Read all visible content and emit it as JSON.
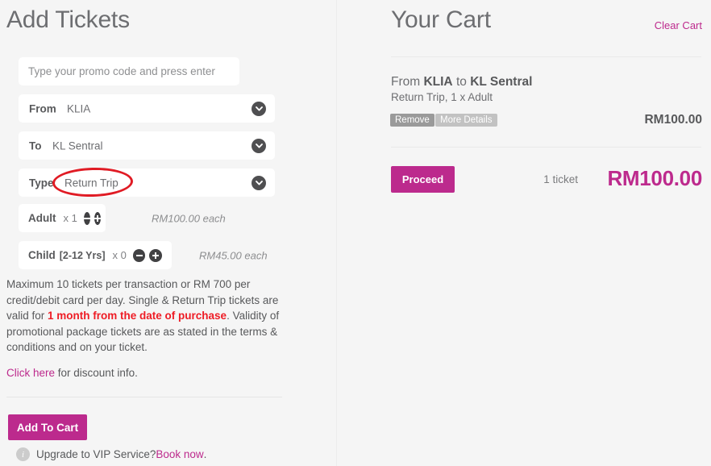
{
  "left": {
    "title": "Add Tickets",
    "promo": {
      "placeholder": "Type your promo code and press enter",
      "value": ""
    },
    "fields": [
      {
        "label": "From",
        "value": "KLIA",
        "icon": "chevron-down-icon"
      },
      {
        "label": "To",
        "value": "KL Sentral",
        "icon": "chevron-down-icon"
      },
      {
        "label": "Type",
        "value": "Return Trip",
        "icon": "chevron-down-icon"
      }
    ],
    "quantities": [
      {
        "name": "Adult",
        "age": "",
        "count": "x 1",
        "price": "RM100.00 each"
      },
      {
        "name": "Child",
        "age": "[2-12 Yrs]",
        "count": "x 0",
        "price": "RM45.00 each"
      }
    ],
    "info_text": {
      "part1": "Maximum 10 tickets per transaction or RM 700 per credit/debit card per day. Single & Return Trip tickets are valid for ",
      "highlight": "1 month from the date of purchase",
      "part2": ". Validity of promotional package tickets are  as stated in the terms & conditions and on your ticket."
    },
    "discount": {
      "link": "Click here",
      "rest": " for discount info."
    },
    "add_to_cart_label": "Add To Cart",
    "vip": {
      "icon": "info-icon",
      "text": "Upgrade to VIP Service? ",
      "link": "Book now",
      "suffix": "."
    }
  },
  "cart": {
    "title": "Your Cart",
    "clear_label": "Clear Cart",
    "item": {
      "route_prefix": "From ",
      "origin": "KLIA",
      "route_mid": " to ",
      "destination": "KL Sentral",
      "sub": "Return Trip, 1 x Adult",
      "remove_label": "Remove",
      "more_details_label": "More Details",
      "price": "RM100.00"
    },
    "proceed_label": "Proceed",
    "ticket_count": "1 ticket",
    "total": "RM100.00"
  },
  "annotation": {
    "type": "ellipse",
    "target": "Return Trip",
    "color": "#e01b24"
  },
  "colors": {
    "brand_magenta": "#bc2a8d",
    "page_background": "#f5f5f5",
    "field_background": "#ffffff",
    "text": "#58595b",
    "alert_red": "#ee1c25",
    "annotation_red": "#e01b24"
  }
}
